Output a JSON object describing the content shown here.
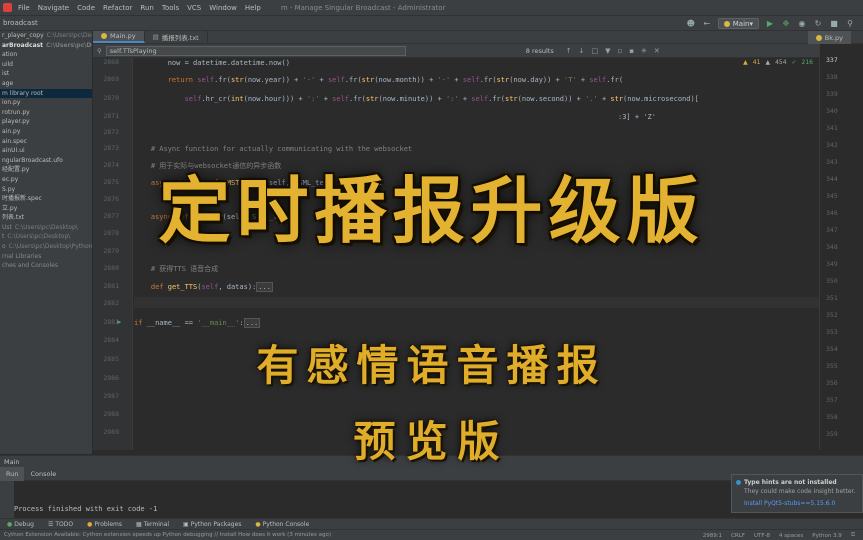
{
  "menubar": {
    "items": [
      "File",
      "Navigate",
      "Code",
      "Refactor",
      "Run",
      "Tools",
      "VCS",
      "Window",
      "Help"
    ],
    "window_title": "m - Manage Singular Broadcast - Administrator"
  },
  "toolbar": {
    "breadcrumb": "broadcast",
    "run_config": "Main"
  },
  "tabs": {
    "items": [
      "Main.py",
      "播报列表.txt"
    ],
    "right_tab": "Bk.py"
  },
  "findbar": {
    "query": "self.TTsPlaying",
    "results": "8 results"
  },
  "project": {
    "rows": [
      {
        "label": "r_player_copy",
        "path": "C:\\Users\\pc\\Desktop\\Python-Co"
      },
      {
        "label": "arBroadcast",
        "path": "C:\\Users\\pc\\Desktop"
      },
      {
        "label": "ation",
        "path": ""
      },
      {
        "label": "uild",
        "path": ""
      },
      {
        "label": "ist",
        "path": ""
      },
      {
        "label": "age",
        "path": ""
      },
      {
        "label": "m library root",
        "path": ""
      },
      {
        "label": "ion.py",
        "path": ""
      },
      {
        "label": "rotrun.py",
        "path": ""
      },
      {
        "label": "player.py",
        "path": ""
      },
      {
        "label": "ain.py",
        "path": ""
      },
      {
        "label": "ain.spec",
        "path": ""
      },
      {
        "label": "ainUI.ui",
        "path": ""
      },
      {
        "label": "ngularBroadcast.ufo",
        "path": ""
      },
      {
        "label": "经配置.py",
        "path": ""
      },
      {
        "label": "ec.py",
        "path": ""
      },
      {
        "label": "S.py",
        "path": ""
      },
      {
        "label": "时播报新.spec",
        "path": ""
      },
      {
        "label": "立.py",
        "path": ""
      },
      {
        "label": "列表.txt",
        "path": ""
      },
      {
        "label": "Ust",
        "path": "C:\\Users\\pc\\Desktop\\"
      },
      {
        "label": "t",
        "path": "C:\\Users\\pc\\Desktop\\"
      },
      {
        "label": "o",
        "path": "C:\\Users\\pc\\Desktop\\Python"
      },
      {
        "label": "rnal Libraries",
        "path": ""
      },
      {
        "label": "ches and Consoles",
        "path": ""
      }
    ]
  },
  "gutter": {
    "lines": [
      "2868",
      "2869",
      "2870",
      "2871",
      "2872",
      "2873",
      "2874",
      "2875",
      "2876",
      "2877",
      "2878",
      "2879",
      "2880",
      "2881",
      "2882",
      "2883",
      "2884",
      "2885",
      "2986",
      "2987",
      "2988",
      "2989",
      "2990",
      "3035"
    ]
  },
  "code": {
    "now_line": "now = datetime.datetime.now()",
    "return_kw": "return",
    "fold_sample": "...",
    "comment_async_en": "# Async function for actually communicating with the websocket",
    "comment_async_cn": "# 用于实际与websocket通信的异步函数",
    "async_def": "async def",
    "transfer_fn": "transferMSTTSData",
    "transfer_args": "(self, SSML_text, filename):",
    "async_def2": "async def",
    "second_args": "(self, SSML_text):",
    "comment_tts": "# 获得TTS 语音合成",
    "get_tts": "def get_TTS(self, datas):",
    "main_guard": "if __name__ == '__main__':",
    "cont_line": ":3] + 'Z'"
  },
  "inspections": {
    "warnings": "41",
    "weak": "454",
    "typos": "216"
  },
  "right_numbers": [
    "337",
    "338",
    "339",
    "340",
    "341",
    "342",
    "343",
    "344",
    "345",
    "346",
    "347",
    "348",
    "349",
    "350",
    "351",
    "352",
    "353",
    "354",
    "355",
    "356",
    "357",
    "358",
    "359"
  ],
  "run_panel": {
    "header": "Main",
    "tabs": [
      "Run",
      "Console"
    ],
    "output": "Process finished with exit code -1"
  },
  "toolwindows": [
    "Debug",
    "TODO",
    "Problems",
    "Terminal",
    "Python Packages",
    "Python Console"
  ],
  "status": {
    "message": "Cython Extension Available: Cython extension speeds up Python debugging // Install  How does it work (3 minutes ago)",
    "position": "2989:1",
    "line_sep": "CRLF",
    "encoding": "UTF-8",
    "indent": "4 spaces",
    "interpreter": "Python 3.9"
  },
  "notification": {
    "title": "Type hints are not installed",
    "body": "They could make code insight better.",
    "action": "Install PyQt5-stubs==5.15.6.0"
  },
  "overlay": {
    "title": "定时播报升级版",
    "subtitle": "有感情语音播报",
    "preview": "预览版"
  }
}
